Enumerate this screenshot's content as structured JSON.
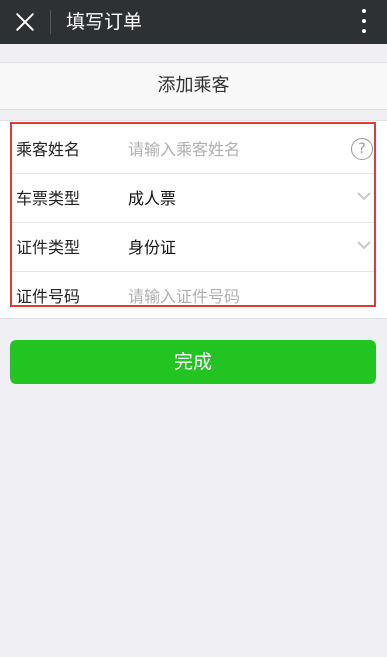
{
  "header": {
    "title": "填写订单",
    "close_icon": "close-icon",
    "more_icon": "more-vertical-icon"
  },
  "add_passenger": {
    "label": "添加乘客"
  },
  "form": {
    "rows": [
      {
        "label": "乘客姓名",
        "placeholder": "请输入乘客姓名",
        "value": "",
        "icon": "help-icon"
      },
      {
        "label": "车票类型",
        "value": "成人票",
        "icon": "chevron-down-icon"
      },
      {
        "label": "证件类型",
        "value": "身份证",
        "icon": "chevron-down-icon"
      },
      {
        "label": "证件号码",
        "placeholder": "请输入证件号码",
        "value": ""
      }
    ]
  },
  "actions": {
    "done_label": "完成"
  },
  "colors": {
    "header_bg": "#2e3134",
    "primary": "#22c422",
    "highlight": "#e03a3a"
  }
}
